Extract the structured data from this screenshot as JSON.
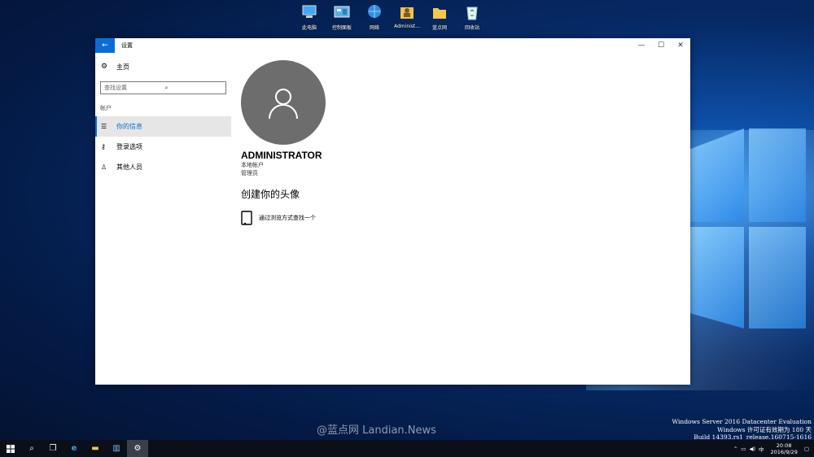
{
  "desktop": {
    "icons": [
      {
        "label": "此电脑",
        "icon": "this-pc-icon"
      },
      {
        "label": "控制面板",
        "icon": "control-panel-icon"
      },
      {
        "label": "网络",
        "icon": "network-icon"
      },
      {
        "label": "Administ...",
        "icon": "user-folder-icon"
      },
      {
        "label": "蓝点网",
        "icon": "folder-icon"
      },
      {
        "label": "回收站",
        "icon": "recycle-bin-icon"
      }
    ],
    "watermark": "@蓝点网 Landian.News",
    "eval": [
      "Windows Server 2016 Datacenter Evaluation",
      "Windows 许可证有效期为 180 天",
      "Build 14393.rs1_release.160715-1616"
    ]
  },
  "window": {
    "title": "设置",
    "back": "←",
    "min": "—",
    "max": "☐",
    "close": "✕"
  },
  "sidebar": {
    "home": "主页",
    "search_placeholder": "查找设置",
    "section": "帐户",
    "items": [
      {
        "label": "你的信息",
        "icon": "info-icon"
      },
      {
        "label": "登录选项",
        "icon": "key-icon"
      },
      {
        "label": "其他人员",
        "icon": "person-icon"
      }
    ]
  },
  "main": {
    "username": "ADMINISTRATOR",
    "account_type": "本地帐户",
    "role": "管理员",
    "create_heading": "创建你的头像",
    "browse_label": "通过浏览方式查找一个"
  },
  "taskbar": {
    "time": "20:08",
    "date": "2016/9/29",
    "ime": "中"
  },
  "colors": {
    "accent": "#0a6dd6"
  }
}
